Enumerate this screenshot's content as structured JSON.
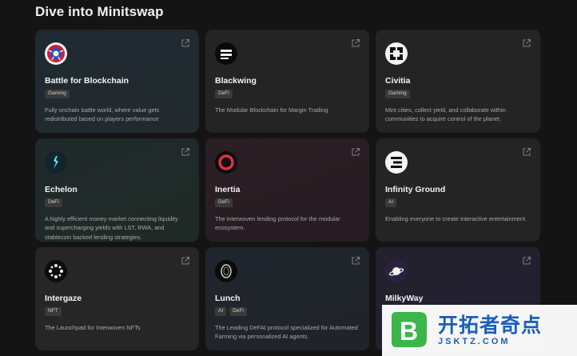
{
  "section": {
    "title": "Dive into Minitswap"
  },
  "cards": [
    {
      "name": "Battle for Blockchain",
      "tags": [
        "Gaming"
      ],
      "description": "Fully onchain battle world, where value gets redistributed based on players performance",
      "icon": "battle-for-blockchain-logo-icon"
    },
    {
      "name": "Blackwing",
      "tags": [
        "DeFi"
      ],
      "description": "The Modular Blockchain for Margin Trading",
      "icon": "blackwing-logo-icon"
    },
    {
      "name": "Civitia",
      "tags": [
        "Gaming"
      ],
      "description": "Mint cities, collect yield, and collaborate within communities to acquire control of the planet.",
      "icon": "civitia-logo-icon"
    },
    {
      "name": "Echelon",
      "tags": [
        "DeFi"
      ],
      "description": "A highly efficient money market connecting liquidity and supercharging yields with LST, RWA, and stablecoin backed lending strategies.",
      "icon": "echelon-logo-icon"
    },
    {
      "name": "Inertia",
      "tags": [
        "DeFi"
      ],
      "description": "The interwoven lending protocol for the modular ecosystem.",
      "icon": "inertia-logo-icon"
    },
    {
      "name": "Infinity Ground",
      "tags": [
        "AI"
      ],
      "description": "Enabling everyone to create interactive entertainment.",
      "icon": "infinity-ground-logo-icon"
    },
    {
      "name": "Intergaze",
      "tags": [
        "NFT"
      ],
      "description": "The Launchpad for Interwoven NFTs",
      "icon": "intergaze-logo-icon"
    },
    {
      "name": "Lunch",
      "tags": [
        "AI",
        "DeFi"
      ],
      "description": "The Leading DeFAI protocol specialized for Automated Farming via personalized AI agents.",
      "icon": "lunch-logo-icon"
    },
    {
      "name": "MilkyWay",
      "tags": [],
      "description": "",
      "icon": "milkyway-logo-icon"
    }
  ],
  "watermark": {
    "title": "开拓者奇点",
    "url": "JSKTZ.COM"
  },
  "colors": {
    "background": "#141414",
    "card": "#242424",
    "tag": "#3a3a3a",
    "inertia_accent": "#e0304a",
    "watermark_green": "#3cb54a",
    "watermark_blue": "#1a5fb8"
  }
}
